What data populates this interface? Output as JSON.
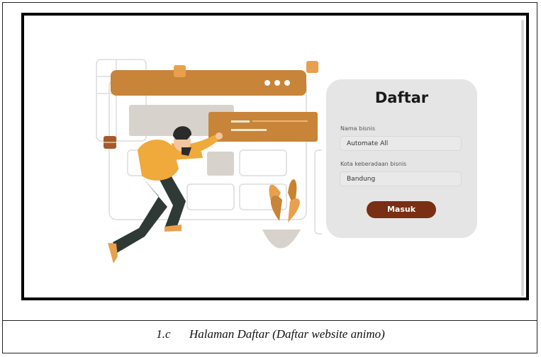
{
  "form": {
    "title": "Daftar",
    "business_name_label": "Nama bisnis",
    "business_name_value": "Automate All",
    "city_label": "Kota keberadaan bisnis",
    "city_value": "Bandung",
    "submit_label": "Masuk"
  },
  "caption": {
    "number": "1.c",
    "text": "Halaman Daftar (Daftar  website animo)"
  },
  "colors": {
    "accent": "#c88438",
    "button": "#7a2e14",
    "card_bg": "#e5e5e5"
  },
  "icons": {
    "window_dots": "three-dots-icon",
    "illustration": "person-browser-illustration"
  }
}
